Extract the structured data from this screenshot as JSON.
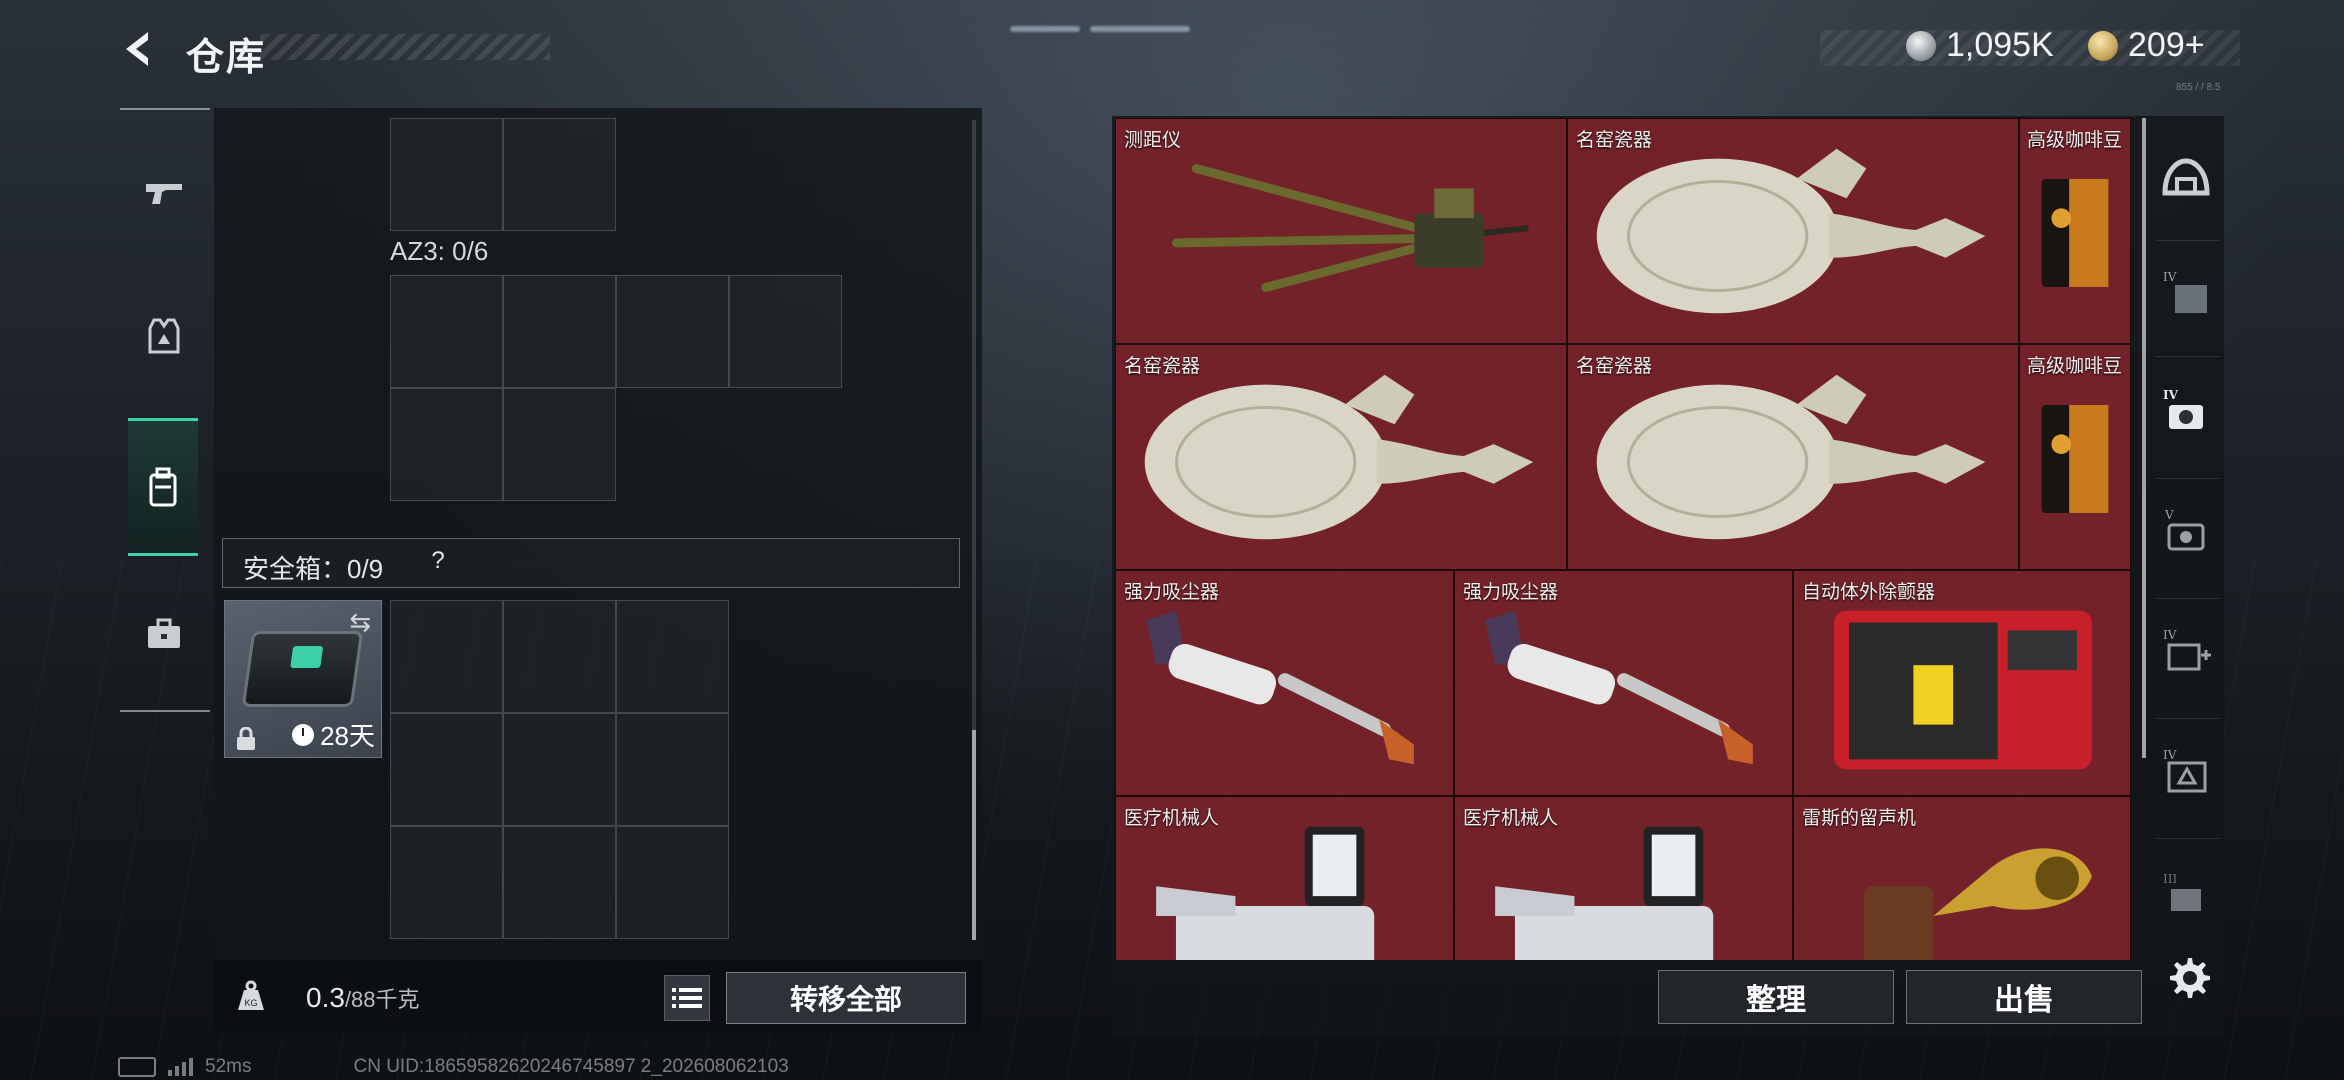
{
  "header": {
    "title": "仓库",
    "currency": [
      {
        "icon": "silver-coin-icon",
        "value": "1,095K"
      },
      {
        "icon": "gold-coin-icon",
        "value": "209+"
      }
    ],
    "version": "855 / / 8.5"
  },
  "left_tabs": [
    {
      "name": "weapon-tab",
      "icon": "pistol-icon",
      "active": false
    },
    {
      "name": "gear-tab",
      "icon": "vest-icon",
      "active": false
    },
    {
      "name": "backpack-tab",
      "icon": "backpack-icon",
      "active": true
    },
    {
      "name": "case-tab",
      "icon": "briefcase-icon",
      "active": false
    }
  ],
  "container": {
    "az3_label": "AZ3: 0/6",
    "safe_box_label": "安全箱：0/9",
    "safe_box_help": "?",
    "safe_item_days": "28天",
    "weight_value": "0.3",
    "weight_max": "/88千克",
    "transfer_all": "转移全部"
  },
  "stash_items": [
    {
      "name": "测距仪",
      "icon": "rangefinder-icon"
    },
    {
      "name": "名窑瓷器",
      "icon": "porcelain-vase-icon"
    },
    {
      "name": "高级咖啡豆",
      "icon": "coffee-bag-icon"
    },
    {
      "name": "名窑瓷器",
      "icon": "porcelain-vase-icon"
    },
    {
      "name": "名窑瓷器",
      "icon": "porcelain-vase-icon"
    },
    {
      "name": "高级咖啡豆",
      "icon": "coffee-bag-icon"
    },
    {
      "name": "强力吸尘器",
      "icon": "vacuum-icon"
    },
    {
      "name": "强力吸尘器",
      "icon": "vacuum-icon"
    },
    {
      "name": "自动体外除颤器",
      "icon": "aed-icon"
    },
    {
      "name": "医疗机械人",
      "icon": "medical-robot-icon"
    },
    {
      "name": "医疗机械人",
      "icon": "medical-robot-icon"
    },
    {
      "name": "雷斯的留声机",
      "icon": "gramophone-icon"
    }
  ],
  "right_tabs": [
    "helmet-tab",
    "tier-iv-box-tab",
    "tier-iv-camera-tab",
    "tier-v-camera-tab",
    "tier-iv-medkit-tab",
    "tier-iv-armor-tab",
    "tier-iii-tool-tab"
  ],
  "actions": {
    "organize": "整理",
    "sell": "出售"
  },
  "status": {
    "ping": "52ms",
    "uid": "CN UID:18659582620246745897 2_202608062103"
  },
  "colors": {
    "accent": "#3fcfa8",
    "stash_bg": "#3a1417",
    "item_bg": "#7a242c"
  }
}
